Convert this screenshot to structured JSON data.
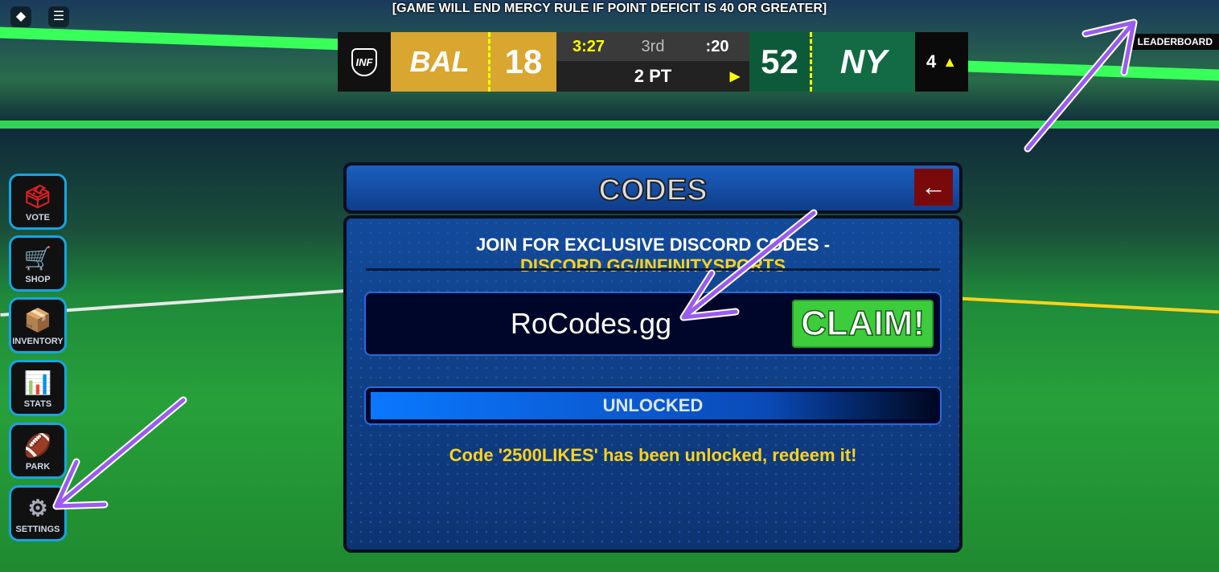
{
  "banner": "[GAME WILL END MERCY RULE IF POINT DEFICIT IS 40 OR GREATER]",
  "scoreboard": {
    "logo": "INF",
    "home_team": "BAL",
    "home_score": "18",
    "clock": "3:27",
    "quarter": "3rd",
    "play_clock": ":20",
    "down": "2 PT",
    "away_score": "52",
    "away_team": "NY",
    "timeouts": "4",
    "home_color": "#d9a630",
    "away_color": "#136b45"
  },
  "leaderboard": "LEADERBOARD",
  "sidebar": [
    {
      "label": "VOTE",
      "icon": "ballot-box-icon"
    },
    {
      "label": "SHOP",
      "icon": "cart-icon"
    },
    {
      "label": "INVENTORY",
      "icon": "box-icon"
    },
    {
      "label": "STATS",
      "icon": "bar-chart-icon"
    },
    {
      "label": "PARK",
      "icon": "football-icon"
    },
    {
      "label": "SETTINGS",
      "icon": "gear-icon"
    }
  ],
  "codes": {
    "title": "CODES",
    "join_text": "JOIN FOR EXCLUSIVE DISCORD CODES - ",
    "discord": "DISCORD.GG/INFINITYSPORTS",
    "code_value": "RoCodes.gg",
    "claim": "CLAIM!",
    "progress_label": "UNLOCKED",
    "progress": 1.0,
    "message": "Code '2500LIKES' has been unlocked, redeem it!"
  }
}
